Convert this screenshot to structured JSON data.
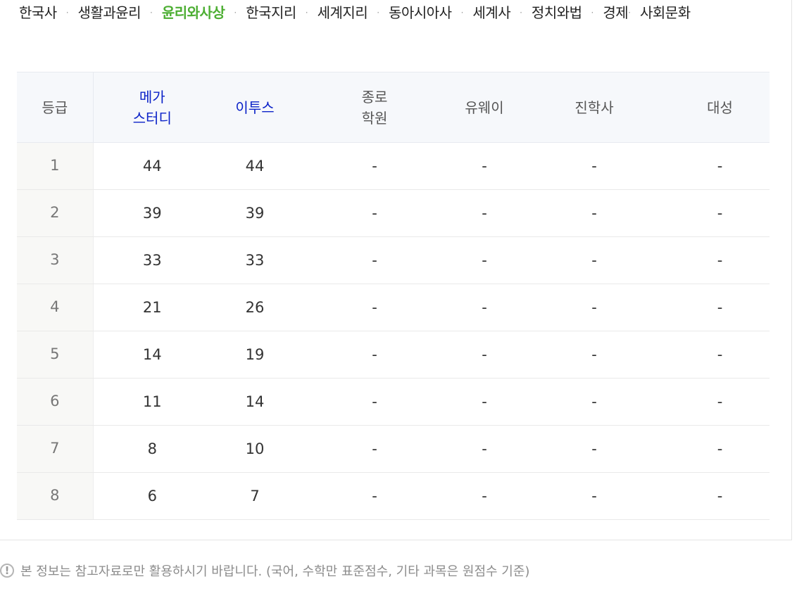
{
  "tabs": [
    {
      "label": "한국사",
      "active": false
    },
    {
      "label": "생활과윤리",
      "active": false
    },
    {
      "label": "윤리와사상",
      "active": true
    },
    {
      "label": "한국지리",
      "active": false
    },
    {
      "label": "세계지리",
      "active": false
    },
    {
      "label": "동아시아사",
      "active": false
    },
    {
      "label": "세계사",
      "active": false
    },
    {
      "label": "정치와법",
      "active": false
    },
    {
      "label": "경제",
      "active": false
    },
    {
      "label": "사회문화",
      "active": false
    }
  ],
  "separator": "·",
  "table": {
    "headers": {
      "grade": "등급",
      "megastudy": [
        "메가",
        "스터디"
      ],
      "etoos": "이투스",
      "jongro": [
        "종로",
        "학원"
      ],
      "uway": "유웨이",
      "jinhak": "진학사",
      "daesung": "대성"
    },
    "rows": [
      {
        "grade": "1",
        "megastudy": "44",
        "etoos": "44",
        "jongro": "-",
        "uway": "-",
        "jinhak": "-",
        "daesung": "-"
      },
      {
        "grade": "2",
        "megastudy": "39",
        "etoos": "39",
        "jongro": "-",
        "uway": "-",
        "jinhak": "-",
        "daesung": "-"
      },
      {
        "grade": "3",
        "megastudy": "33",
        "etoos": "33",
        "jongro": "-",
        "uway": "-",
        "jinhak": "-",
        "daesung": "-"
      },
      {
        "grade": "4",
        "megastudy": "21",
        "etoos": "26",
        "jongro": "-",
        "uway": "-",
        "jinhak": "-",
        "daesung": "-"
      },
      {
        "grade": "5",
        "megastudy": "14",
        "etoos": "19",
        "jongro": "-",
        "uway": "-",
        "jinhak": "-",
        "daesung": "-"
      },
      {
        "grade": "6",
        "megastudy": "11",
        "etoos": "14",
        "jongro": "-",
        "uway": "-",
        "jinhak": "-",
        "daesung": "-"
      },
      {
        "grade": "7",
        "megastudy": "8",
        "etoos": "10",
        "jongro": "-",
        "uway": "-",
        "jinhak": "-",
        "daesung": "-"
      },
      {
        "grade": "8",
        "megastudy": "6",
        "etoos": "7",
        "jongro": "-",
        "uway": "-",
        "jinhak": "-",
        "daesung": "-"
      }
    ]
  },
  "notice": {
    "icon": "exclamation-circle-icon",
    "glyph": "!",
    "text": "본 정보는 참고자료로만 활용하시기 바랍니다. (국어, 수학만 표준점수, 기타 과목은 원점수 기준)"
  },
  "colors": {
    "active_tab": "#4cae32",
    "link_header": "#0b22c8",
    "header_bg": "#f6f8fb",
    "grade_col_bg": "#f8f8f6"
  }
}
